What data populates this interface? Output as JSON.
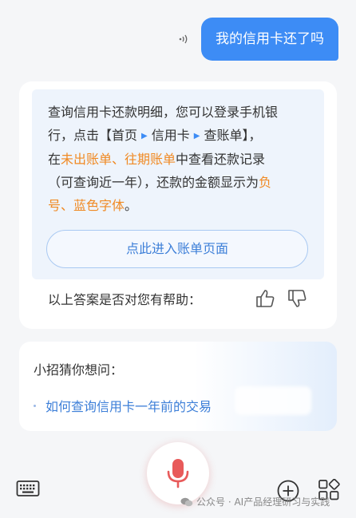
{
  "user_message": "我的信用卡还了吗",
  "answer": {
    "line1": "查询信用卡还款明细，您可以登录手机银",
    "line2_a": "行，点击【首页",
    "line2_b": "信用卡",
    "line2_c": "查账单】，",
    "line3_a": "在",
    "line3_b": "未出账单、往期账单",
    "line3_c": "中查看还款记录",
    "line4_a": "（可查询近一年），还款的金额显示为",
    "line4_b": "负",
    "line5_a": "号、蓝色字体",
    "line5_b": "。",
    "bill_button": "点此进入账单页面",
    "helpful_question": "以上答案是否对您有帮助："
  },
  "guess": {
    "title": "小招猜你想问：",
    "items": [
      "如何查询信用卡一年前的交易"
    ]
  },
  "watermark": "公众号 · AI产品经理研习与实践",
  "colors": {
    "accent": "#3d8cf5",
    "highlight": "#f08a24",
    "mic": "#e85a5a"
  }
}
